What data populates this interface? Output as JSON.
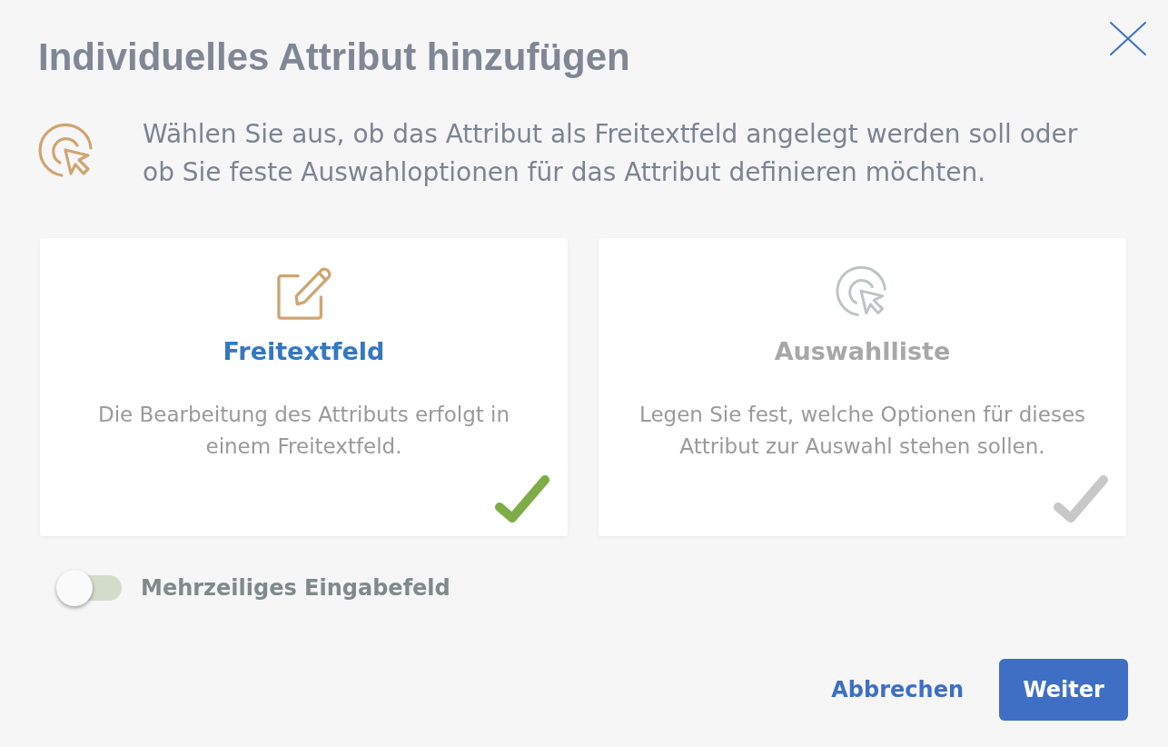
{
  "dialog": {
    "title": "Individuelles Attribut hinzufügen"
  },
  "intro": {
    "text": "Wählen Sie aus, ob das Attribut als Freitextfeld angelegt werden soll oder ob Sie feste Auswahloptionen für das Attribut definieren möchten."
  },
  "options": [
    {
      "kind": "text",
      "title": "Freitextfeld",
      "description": "Die Bearbeitung des Attributs erfolgt in einem Freitextfeld.",
      "selected": true
    },
    {
      "kind": "choice",
      "title": "Auswahlliste",
      "description": "Legen Sie fest, welche Optionen für dieses Attribut zur Auswahl stehen sollen.",
      "selected": false
    }
  ],
  "multiline_toggle": {
    "label": "Mehrzeiliges Eingabefeld",
    "on": false
  },
  "buttons": [
    {
      "kind": "link",
      "label": "Abbrechen"
    },
    {
      "kind": "primary",
      "label": "Weiter"
    }
  ]
}
